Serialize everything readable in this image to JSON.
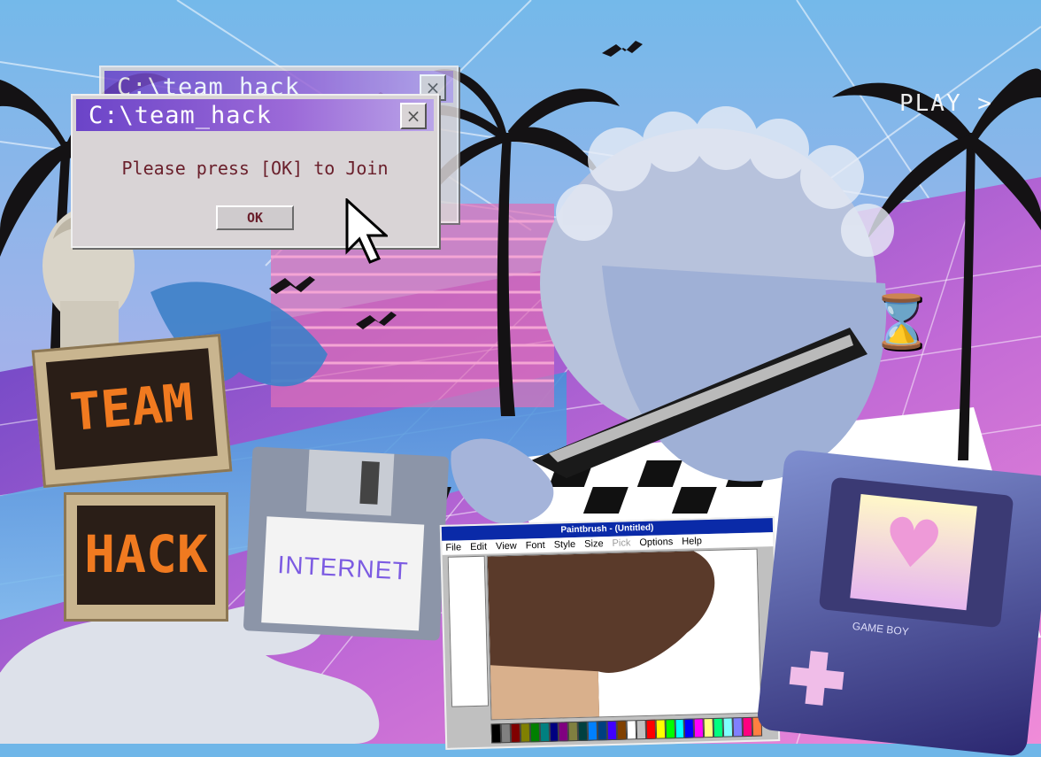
{
  "dialog_back": {
    "title": "C:\\team_hack",
    "close_glyph": "×"
  },
  "dialog_front": {
    "title": "C:\\team_hack",
    "close_glyph": "×",
    "message": "Please press [OK] to Join",
    "ok_label": "OK"
  },
  "play_label": "PLAY >",
  "crt_signs": {
    "top": "TEAM",
    "bottom": "HACK"
  },
  "floppy_label": "INTERNET",
  "paintbrush": {
    "title": "Paintbrush - (Untitled)",
    "menu": [
      "File",
      "Edit",
      "View",
      "Font",
      "Style",
      "Size",
      "Pick",
      "Options",
      "Help"
    ],
    "palette": [
      "#000000",
      "#808080",
      "#800000",
      "#808000",
      "#008000",
      "#008080",
      "#000080",
      "#800080",
      "#808040",
      "#004040",
      "#0080ff",
      "#004080",
      "#4000ff",
      "#804000",
      "#ffffff",
      "#c0c0c0",
      "#ff0000",
      "#ffff00",
      "#00ff00",
      "#00ffff",
      "#0000ff",
      "#ff00ff",
      "#ffff80",
      "#00ff80",
      "#80ffff",
      "#8080ff",
      "#ff0080",
      "#ff8040"
    ]
  },
  "gameboy": {
    "brand_text": "GAME BOY",
    "screen_icon": "pixel-heart-icon"
  },
  "icons": {
    "hourglass": "hourglass-icon",
    "cursor": "pointer-cursor-icon",
    "birds": "bird-icon"
  },
  "colors": {
    "sky": "#6fb6e8",
    "horizon_pink": "#e97ad0",
    "grid_purple": "#5a39b8",
    "dialog_bar": "#6b44c8"
  }
}
